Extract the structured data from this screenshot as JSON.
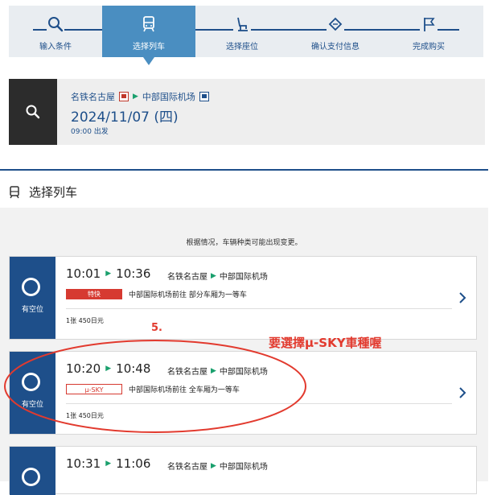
{
  "steps": [
    {
      "label": "输入条件",
      "icon": "search-icon",
      "active": false
    },
    {
      "label": "选择列车",
      "icon": "train-icon",
      "active": true
    },
    {
      "label": "选择座位",
      "icon": "seat-icon",
      "active": false
    },
    {
      "label": "确认支付信息",
      "icon": "ticket-icon",
      "active": false
    },
    {
      "label": "完成购买",
      "icon": "flag-icon",
      "active": false
    }
  ],
  "summary": {
    "from": "名铁名古屋",
    "to": "中部国际机场",
    "date": "2024/11/07 (四)",
    "departure": "09:00 出发"
  },
  "section": {
    "title": "选择列车"
  },
  "notice": "根据情况，车辆种类可能出现变更。",
  "trains": [
    {
      "avail": "有空位",
      "depart": "10:01",
      "arrive": "10:36",
      "from": "名铁名古屋",
      "to": "中部国际机场",
      "type": "特快",
      "type_style": "red",
      "desc": "中部国际机场前往 部分车厢为一等车",
      "price": "1张 450日元"
    },
    {
      "avail": "有空位",
      "depart": "10:20",
      "arrive": "10:48",
      "from": "名铁名古屋",
      "to": "中部国际机场",
      "type": "μ-SKY",
      "type_style": "outline",
      "desc": "中部国际机场前往 全车厢为一等车",
      "price": "1张 450日元"
    },
    {
      "avail": "",
      "depart": "10:31",
      "arrive": "11:06",
      "from": "名铁名古屋",
      "to": "中部国际机场",
      "type": "",
      "type_style": "",
      "desc": "",
      "price": ""
    }
  ],
  "annotation": {
    "step_number": "5.",
    "note": "要選擇μ-SKY車種喔",
    "color": "#e23a2e"
  },
  "colors": {
    "brand": "#1e4f8a",
    "active_step": "#4a8ec1",
    "accent_green": "#1aa06d",
    "badge_red": "#d63a31"
  }
}
